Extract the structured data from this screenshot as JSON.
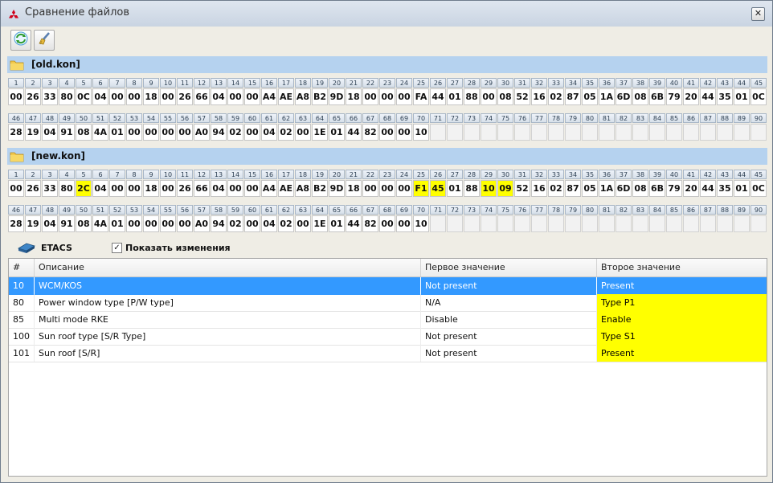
{
  "window": {
    "title": "Сравнение файлов",
    "close_glyph": "✕"
  },
  "toolbar": {
    "buttons": [
      {
        "icon": "refresh-icon"
      },
      {
        "icon": "clear-brush-icon"
      }
    ]
  },
  "colors": {
    "header_band": "#b5d2ef",
    "highlight": "#ffff00",
    "selection": "#3399ff"
  },
  "files": [
    {
      "name": "[old.kon]",
      "rows": [
        {
          "numbers": [
            "1",
            "2",
            "3",
            "4",
            "5",
            "6",
            "7",
            "8",
            "9",
            "10",
            "11",
            "12",
            "13",
            "14",
            "15",
            "16",
            "17",
            "18",
            "19",
            "20",
            "21",
            "22",
            "23",
            "24",
            "25",
            "26",
            "27",
            "28",
            "29",
            "30",
            "31",
            "32",
            "33",
            "34",
            "35",
            "36",
            "37",
            "38",
            "39",
            "40",
            "41",
            "42",
            "43",
            "44",
            "45"
          ],
          "values": [
            "00",
            "26",
            "33",
            "80",
            "0C",
            "04",
            "00",
            "00",
            "18",
            "00",
            "26",
            "66",
            "04",
            "00",
            "00",
            "A4",
            "AE",
            "A8",
            "B2",
            "9D",
            "18",
            "00",
            "00",
            "00",
            "FA",
            "44",
            "01",
            "88",
            "00",
            "08",
            "52",
            "16",
            "02",
            "87",
            "05",
            "1A",
            "6D",
            "08",
            "6B",
            "79",
            "20",
            "44",
            "35",
            "01",
            "0C"
          ],
          "highlight": []
        },
        {
          "numbers": [
            "46",
            "47",
            "48",
            "49",
            "50",
            "51",
            "52",
            "53",
            "54",
            "55",
            "56",
            "57",
            "58",
            "59",
            "60",
            "61",
            "62",
            "63",
            "64",
            "65",
            "66",
            "67",
            "68",
            "69",
            "70",
            "71",
            "72",
            "73",
            "74",
            "75",
            "76",
            "77",
            "78",
            "79",
            "80",
            "81",
            "82",
            "83",
            "84",
            "85",
            "86",
            "87",
            "88",
            "89",
            "90"
          ],
          "values": [
            "28",
            "19",
            "04",
            "91",
            "08",
            "4A",
            "01",
            "00",
            "00",
            "00",
            "00",
            "A0",
            "94",
            "02",
            "00",
            "04",
            "02",
            "00",
            "1E",
            "01",
            "44",
            "82",
            "00",
            "00",
            "10",
            "",
            "",
            "",
            "",
            "",
            "",
            "",
            "",
            "",
            "",
            "",
            "",
            "",
            "",
            "",
            "",
            "",
            "",
            "",
            ""
          ],
          "highlight": []
        }
      ]
    },
    {
      "name": "[new.kon]",
      "rows": [
        {
          "numbers": [
            "1",
            "2",
            "3",
            "4",
            "5",
            "6",
            "7",
            "8",
            "9",
            "10",
            "11",
            "12",
            "13",
            "14",
            "15",
            "16",
            "17",
            "18",
            "19",
            "20",
            "21",
            "22",
            "23",
            "24",
            "25",
            "26",
            "27",
            "28",
            "29",
            "30",
            "31",
            "32",
            "33",
            "34",
            "35",
            "36",
            "37",
            "38",
            "39",
            "40",
            "41",
            "42",
            "43",
            "44",
            "45"
          ],
          "values": [
            "00",
            "26",
            "33",
            "80",
            "2C",
            "04",
            "00",
            "00",
            "18",
            "00",
            "26",
            "66",
            "04",
            "00",
            "00",
            "A4",
            "AE",
            "A8",
            "B2",
            "9D",
            "18",
            "00",
            "00",
            "00",
            "F1",
            "45",
            "01",
            "88",
            "10",
            "09",
            "52",
            "16",
            "02",
            "87",
            "05",
            "1A",
            "6D",
            "08",
            "6B",
            "79",
            "20",
            "44",
            "35",
            "01",
            "0C"
          ],
          "highlight": [
            4,
            24,
            25,
            28,
            29
          ]
        },
        {
          "numbers": [
            "46",
            "47",
            "48",
            "49",
            "50",
            "51",
            "52",
            "53",
            "54",
            "55",
            "56",
            "57",
            "58",
            "59",
            "60",
            "61",
            "62",
            "63",
            "64",
            "65",
            "66",
            "67",
            "68",
            "69",
            "70",
            "71",
            "72",
            "73",
            "74",
            "75",
            "76",
            "77",
            "78",
            "79",
            "80",
            "81",
            "82",
            "83",
            "84",
            "85",
            "86",
            "87",
            "88",
            "89",
            "90"
          ],
          "values": [
            "28",
            "19",
            "04",
            "91",
            "08",
            "4A",
            "01",
            "00",
            "00",
            "00",
            "00",
            "A0",
            "94",
            "02",
            "00",
            "04",
            "02",
            "00",
            "1E",
            "01",
            "44",
            "82",
            "00",
            "00",
            "10",
            "",
            "",
            "",
            "",
            "",
            "",
            "",
            "",
            "",
            "",
            "",
            "",
            "",
            "",
            "",
            "",
            "",
            "",
            "",
            ""
          ],
          "highlight": []
        }
      ]
    }
  ],
  "etacs": {
    "label": "ETACS",
    "icon": "etacs-device-icon",
    "checkbox_label": "Показать изменения",
    "checkbox_checked": true,
    "check_glyph": "✓"
  },
  "table": {
    "headers": [
      "#",
      "Описание",
      "Первое значение",
      "Второе значение"
    ],
    "rows": [
      {
        "num": "10",
        "desc": "WCM/KOS",
        "first": "Not present",
        "second": "Present",
        "selected": true,
        "changed": false
      },
      {
        "num": "80",
        "desc": "Power window type  [P/W type]",
        "first": "N/A",
        "second": "Type P1",
        "selected": false,
        "changed": true
      },
      {
        "num": "85",
        "desc": "Multi mode RKE",
        "first": "Disable",
        "second": "Enable",
        "selected": false,
        "changed": true
      },
      {
        "num": "100",
        "desc": "Sun roof type  [S/R Type]",
        "first": "Not present",
        "second": "Type S1",
        "selected": false,
        "changed": true
      },
      {
        "num": "101",
        "desc": "Sun roof  [S/R]",
        "first": "Not present",
        "second": "Present",
        "selected": false,
        "changed": true
      }
    ]
  }
}
